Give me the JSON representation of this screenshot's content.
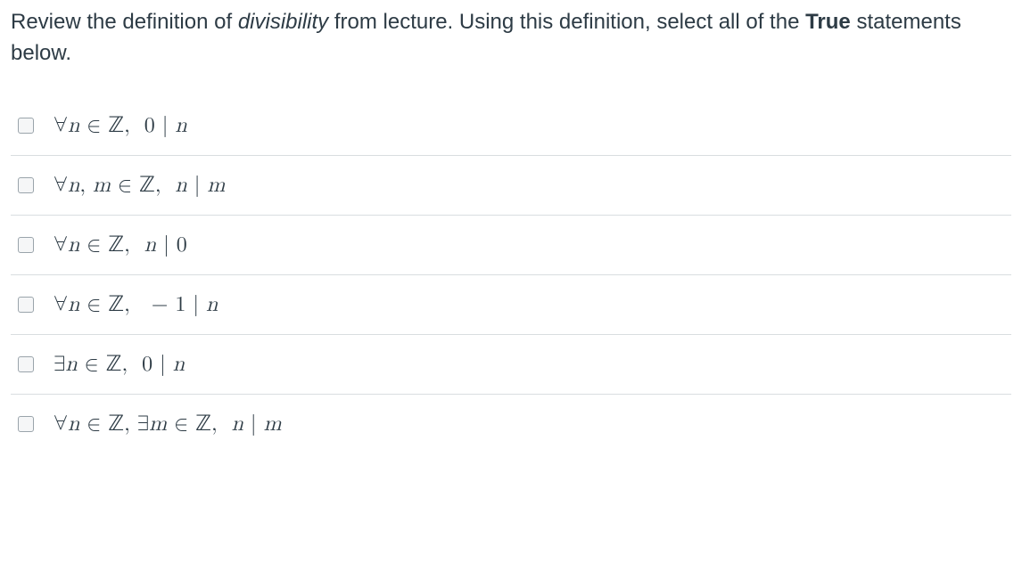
{
  "question": {
    "prefix": "Review the definition of ",
    "term": "divisibility",
    "mid": " from lecture. Using this definition, select all of the ",
    "bold": "True",
    "suffix": " statements below."
  },
  "options": [
    "∀n ∈ ℤ,  0 | n",
    "∀n, m ∈ ℤ,  n | m",
    "∀n ∈ ℤ,  n | 0",
    "∀n ∈ ℤ,   − 1 | n",
    "∃n ∈ ℤ,  0 | n",
    "∀n ∈ ℤ, ∃m ∈ ℤ,  n | m"
  ]
}
